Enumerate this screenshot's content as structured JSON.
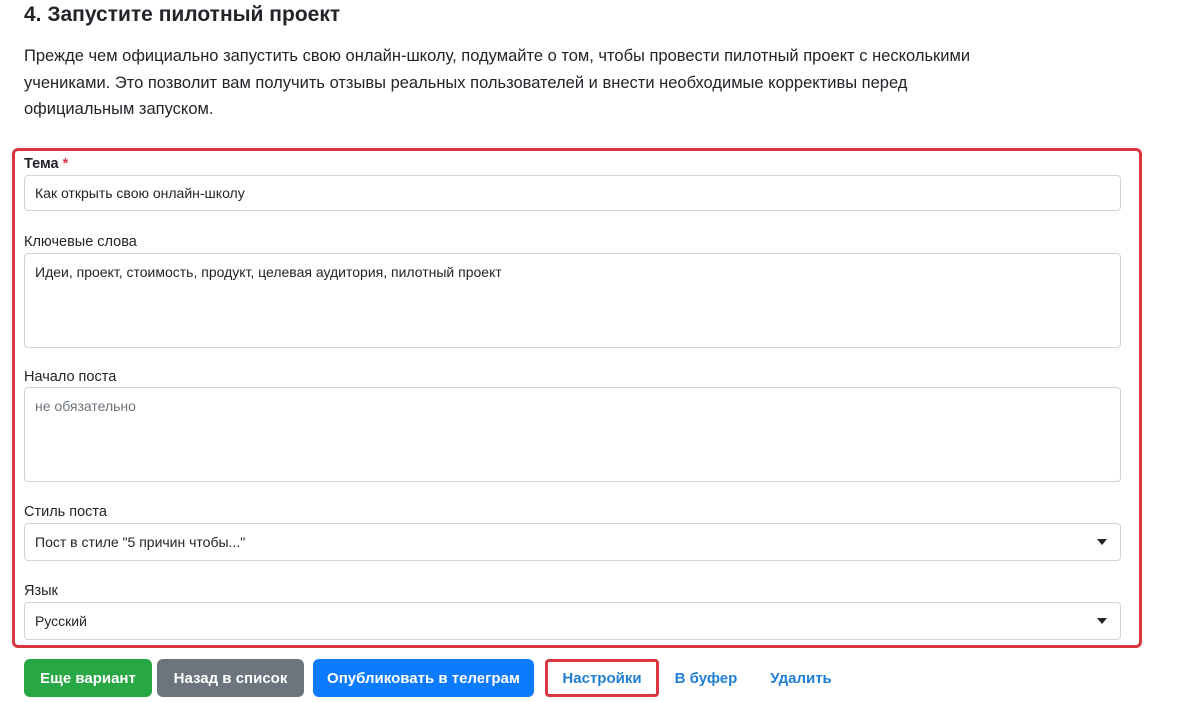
{
  "section": {
    "heading": "4. Запустите пилотный проект",
    "intro": "Прежде чем официально запустить свою онлайн-школу, подумайте о том, чтобы провести пилотный проект с несколькими учениками. Это позволит вам получить отзывы реальных пользователей и внести необходимые коррективы перед официальным запуском."
  },
  "form": {
    "topic": {
      "label": "Тема",
      "required_mark": "*",
      "value": "Как открыть свою онлайн-школу"
    },
    "keywords": {
      "label": "Ключевые слова",
      "value": "Идеи, проект, стоимость, продукт, целевая аудитория, пилотный проект"
    },
    "post_start": {
      "label": "Начало поста",
      "value": "",
      "placeholder": "не обязательно"
    },
    "post_style": {
      "label": "Стиль поста",
      "selected": "Пост в стиле \"5 причин чтобы...\""
    },
    "language": {
      "label": "Язык",
      "selected": "Русский"
    }
  },
  "actions": {
    "another_variant": "Еще вариант",
    "back_to_list": "Назад в список",
    "publish_telegram": "Опубликовать в телеграм",
    "settings": "Настройки",
    "to_buffer": "В буфер",
    "delete": "Удалить"
  },
  "colors": {
    "highlight": "#d9363e",
    "green": "#28a745",
    "gray": "#6c757d",
    "blue": "#0d7bff",
    "link": "#1f7fd6"
  }
}
